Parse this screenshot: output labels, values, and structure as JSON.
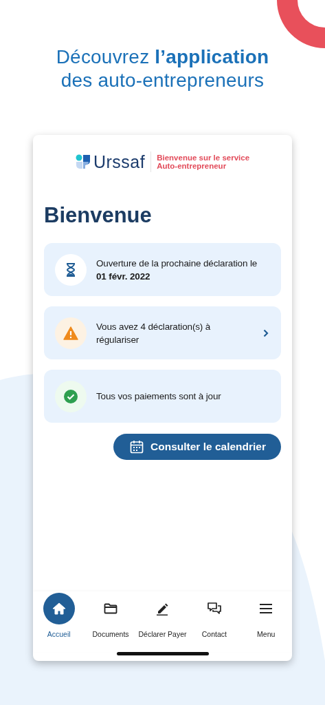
{
  "headline": {
    "line_1": "Découvrez **l’application**",
    "line_2": "des auto-entrepreneurs"
  },
  "header": {
    "logo_text": "Urssaf",
    "tagline_1": "Bienvenue sur le service",
    "tagline_2": "Auto-entrepreneur"
  },
  "page_title": "Bienvenue",
  "cards": [
    {
      "kind": "pending",
      "text": "Ouverture de la prochaine déclaration le **01 févr. 2022**",
      "chevron": false
    },
    {
      "kind": "warning",
      "text": "Vous avez 4 déclaration(s) à régulariser",
      "chevron": true
    },
    {
      "kind": "success",
      "text": "Tous vos paiements sont à jour",
      "chevron": false
    }
  ],
  "calendar_button": "Consulter le calendrier",
  "nav": [
    {
      "kind": "home",
      "label": "Accueil",
      "selected": true
    },
    {
      "kind": "documents",
      "label": "Documents",
      "selected": false
    },
    {
      "kind": "declare",
      "label": "Déclarer Payer",
      "selected": false
    },
    {
      "kind": "contact",
      "label": "Contact",
      "selected": false
    },
    {
      "kind": "menu",
      "label": "Menu",
      "selected": false
    }
  ]
}
